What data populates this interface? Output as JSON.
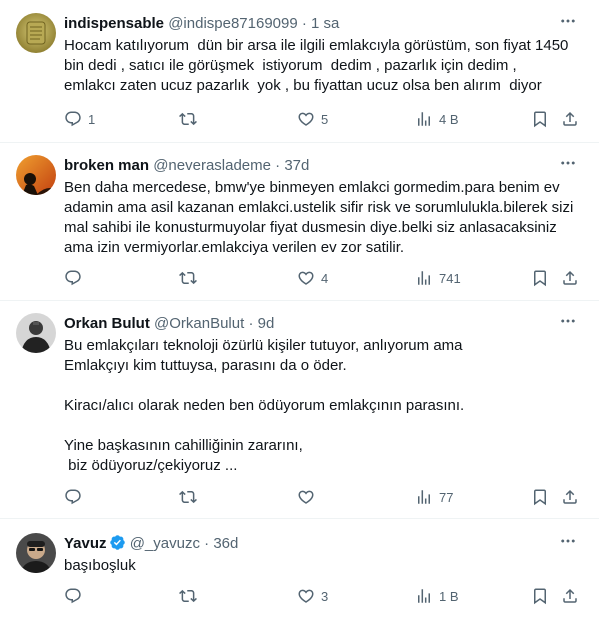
{
  "tweets": [
    {
      "name": "indispensable",
      "handle": "@indispe87169099",
      "dot": "·",
      "time": "1 sa",
      "text": "Hocam katılıyorum  dün bir arsa ile ilgili emlakcıyla görüstüm, son fiyat 1450 bin dedi , satıcı ile görüşmek  istiyorum  dedim , pazarlık için dedim ,\nemlakcı zaten ucuz pazarlık  yok , bu fiyattan ucuz olsa ben alırım  diyor",
      "replies": "1",
      "retweets": "",
      "likes": "5",
      "views": "4 B"
    },
    {
      "name": "broken man",
      "handle": "@neveraslademe",
      "dot": "·",
      "time": "37d",
      "text": "Ben daha mercedese, bmw'ye binmeyen emlakci gormedim.para benim ev adamin ama asil kazanan emlakci.ustelik sifir risk ve sorumlulukla.bilerek sizi mal sahibi ile konusturmuyolar fiyat dusmesin diye.belki siz anlasacaksiniz ama izin vermiyorlar.emlakciya verilen ev zor satilir.",
      "replies": "",
      "retweets": "",
      "likes": "4",
      "views": "741"
    },
    {
      "name": "Orkan Bulut",
      "handle": "@OrkanBulut",
      "dot": "·",
      "time": "9d",
      "text": "Bu emlakçıları teknoloji özürlü kişiler tutuyor, anlıyorum ama\nEmlakçıyı kim tuttuysa, parasını da o öder.\n\nKiracı/alıcı olarak neden ben ödüyorum emlakçının parasını.\n\nYine başkasının cahilliğinin zararını,\n biz ödüyoruz/çekiyoruz ...",
      "replies": "",
      "retweets": "",
      "likes": "",
      "views": "77"
    },
    {
      "name": "Yavuz",
      "handle": "@_yavuzc",
      "dot": "·",
      "time": "36d",
      "text": "başıboşluk",
      "replies": "",
      "retweets": "",
      "likes": "3",
      "views": "1 B"
    }
  ],
  "icons": {
    "reply": "reply-icon",
    "retweet": "retweet-icon",
    "like": "like-icon",
    "views": "views-icon",
    "bookmark": "bookmark-icon",
    "share": "share-icon",
    "more": "more-icon",
    "verified": "verified-badge-icon"
  },
  "colors": {
    "text": "#0f1419",
    "secondary": "#536471",
    "verified": "#1d9bf0",
    "divider": "#eff3f4"
  }
}
